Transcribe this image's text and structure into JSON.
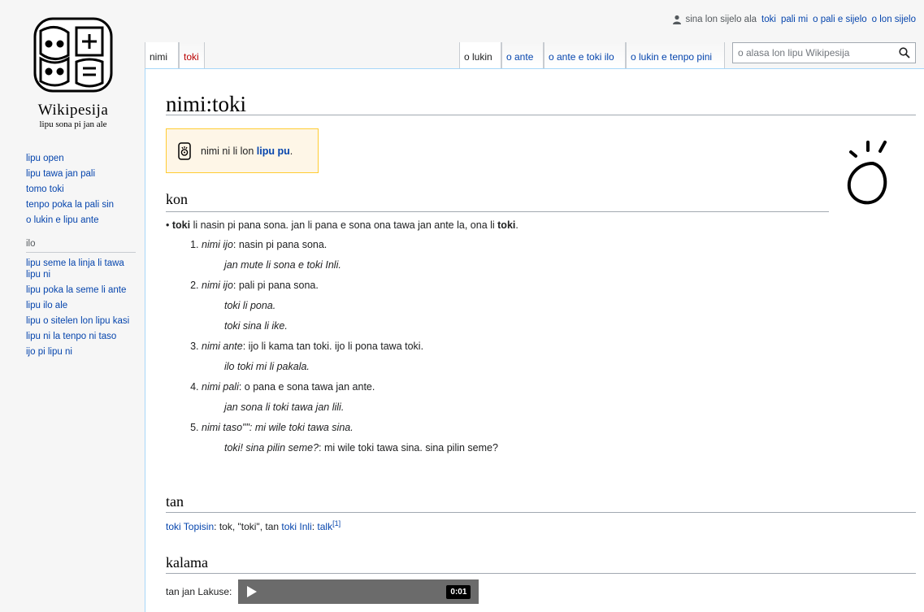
{
  "personal": {
    "user": "sina lon sijelo ala",
    "links": [
      "toki",
      "pali mi",
      "o pali e sijelo",
      "o lon sijelo"
    ]
  },
  "logo": {
    "wordmark": "Wikipesija",
    "tagline": "lipu sona pi jan ale"
  },
  "sidebar": {
    "nav": [
      "lipu open",
      "lipu tawa jan pali",
      "tomo toki",
      "tenpo poka la pali sin",
      "o lukin e lipu ante"
    ],
    "tools_heading": "ilo",
    "tools": [
      "lipu seme la linja li tawa lipu ni",
      "lipu poka la seme li ante",
      "lipu ilo ale",
      "lipu o sitelen lon lipu kasi",
      "lipu ni la tenpo ni taso",
      "ijo pi lipu ni"
    ]
  },
  "tabs": {
    "left": [
      "nimi",
      "toki"
    ],
    "right": [
      "o lukin",
      "o ante",
      "o ante e toki ilo",
      "o lukin e tenpo pini"
    ],
    "search_placeholder": "o alasa lon lipu Wikipesija"
  },
  "page": {
    "title": "nimi:toki",
    "notice_text": "nimi ni li lon ",
    "notice_link": "lipu pu",
    "notice_end": ".",
    "sections": {
      "kon": "kon",
      "tan": "tan",
      "kalama": "kalama"
    },
    "bullet": {
      "word": "toki",
      "text": " li nasin pi pana sona. jan li pana e sona ona tawa jan ante la, ona li ",
      "word2": "toki",
      "end": "."
    },
    "senses": [
      {
        "label": "nimi ijo",
        "def": ": nasin pi pana sona.",
        "examples": [
          "jan mute li sona e toki Inli."
        ]
      },
      {
        "label": "nimi ijo",
        "def": ": pali pi pana sona.",
        "examples": [
          "toki li pona.",
          "toki sina li ike."
        ]
      },
      {
        "label": "nimi ante",
        "def": ": ijo li kama tan toki. ijo li pona tawa toki.",
        "examples": [
          "ilo toki mi li pakala."
        ]
      },
      {
        "label": "nimi pali",
        "def": ": o pana e sona tawa jan ante.",
        "examples": [
          "jan sona li toki tawa jan lili."
        ]
      },
      {
        "label": "nimi taso\"\": mi wile toki tawa sina.",
        "def": "",
        "examples": []
      }
    ],
    "last_example": {
      "italic": "toki! sina pilin seme?",
      "rest": ": mi wile toki tawa sina. sina pilin seme?"
    },
    "tan": {
      "link1": "toki Topisin",
      "mid": ": tok, \"toki\", tan ",
      "link2": "toki Inli",
      "colon": ": ",
      "link3": "talk",
      "ref": "[1]"
    },
    "kalama": {
      "label": "tan jan Lakuse:",
      "time": "0:01"
    }
  }
}
